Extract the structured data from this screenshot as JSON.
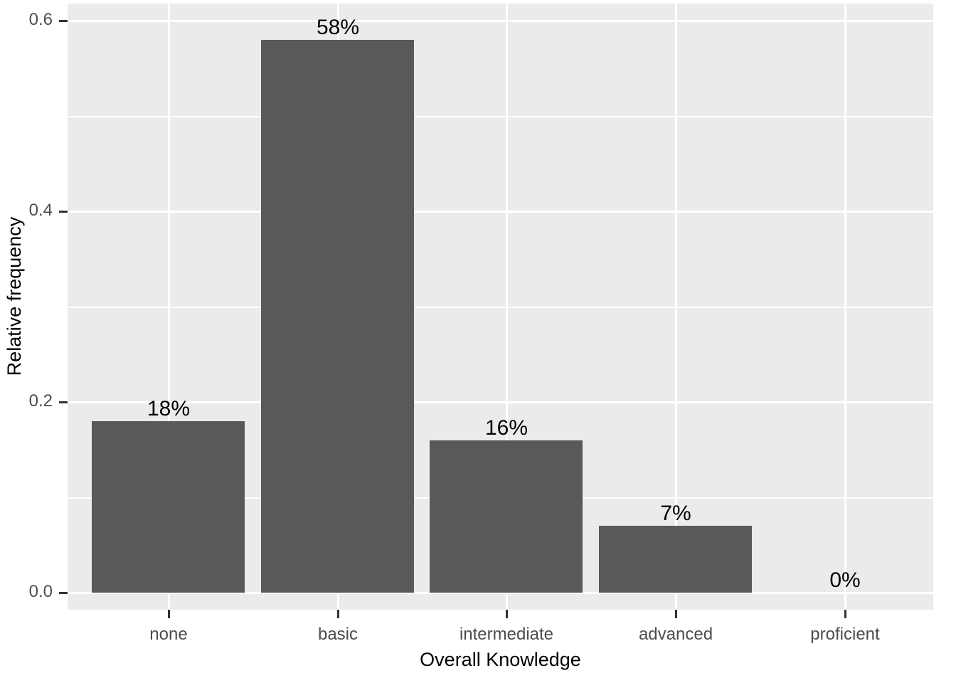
{
  "chart_data": {
    "type": "bar",
    "title": "",
    "subtitle": "",
    "xlabel": "Overall Knowledge",
    "ylabel": "Relative frequency",
    "categories": [
      "none",
      "basic",
      "intermediate",
      "advanced",
      "proficient"
    ],
    "values": [
      0.18,
      0.58,
      0.16,
      0.07,
      0.0
    ],
    "data_labels": [
      "18%",
      "58%",
      "16%",
      "7%",
      "0%"
    ],
    "ylim": [
      0.0,
      0.635
    ],
    "xlim": [
      0.4,
      5.6
    ],
    "y_ticks": [
      {
        "value": 0.0,
        "label": "0.0"
      },
      {
        "value": 0.2,
        "label": "0.2"
      },
      {
        "value": 0.4,
        "label": "0.4"
      },
      {
        "value": 0.6,
        "label": "0.6"
      }
    ],
    "y_minor_ticks": [
      0.1,
      0.3,
      0.5
    ],
    "grid": true,
    "legend": "none",
    "bar_color": "#595959",
    "panel_background": "#EBEBEB",
    "gridline_color": "#FFFFFF",
    "tick_label_color": "#4D4D4D",
    "axis_title_color": "#000000",
    "data_label_color": "#000000"
  }
}
